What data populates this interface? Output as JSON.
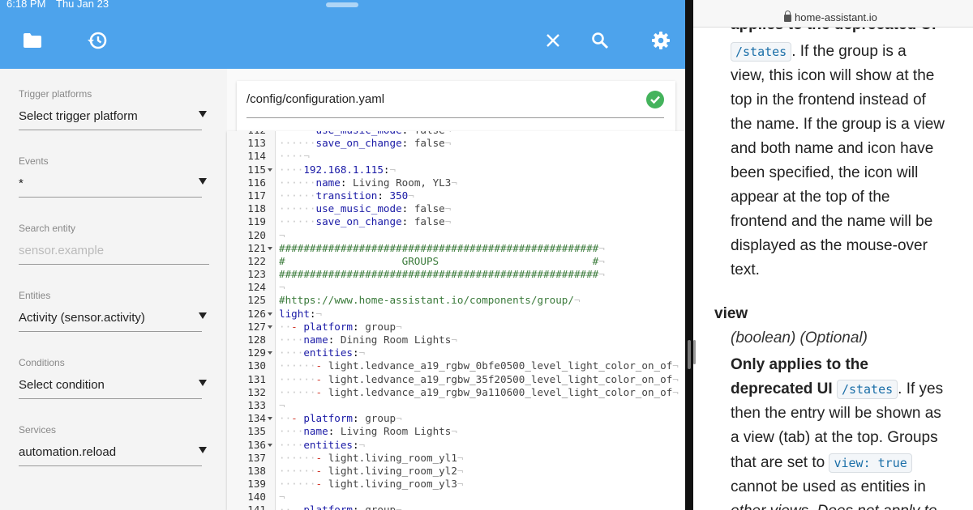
{
  "status_bar": {
    "time": "6:18 PM",
    "date": "Thu Jan 23"
  },
  "toolbar": {
    "icons": [
      "folder-icon",
      "history-icon",
      "close-icon",
      "search-icon",
      "gear-icon"
    ]
  },
  "sidebar": {
    "fields": [
      {
        "label": "Trigger platforms",
        "value": "Select trigger platform",
        "placeholder": false
      },
      {
        "label": "Events",
        "value": "*",
        "placeholder": false
      },
      {
        "label": "Search entity",
        "value": "sensor.example",
        "placeholder": true
      },
      {
        "label": "Entities",
        "value": "Activity (sensor.activity)",
        "placeholder": false
      },
      {
        "label": "Conditions",
        "value": "Select condition",
        "placeholder": false
      },
      {
        "label": "Services",
        "value": "automation.reload",
        "placeholder": false
      }
    ]
  },
  "file": {
    "path": "/config/configuration.yaml",
    "status": "valid"
  },
  "editor": {
    "lines": [
      {
        "n": "112",
        "text": "use_music_mode: false"
      },
      {
        "n": "113",
        "text": "save_on_change: false"
      },
      {
        "n": "114",
        "text": ""
      },
      {
        "n": "115",
        "text": "192.168.1.115:"
      },
      {
        "n": "116",
        "text": "name: Living Room, YL3"
      },
      {
        "n": "117",
        "text": "transition: 350"
      },
      {
        "n": "118",
        "text": "use_music_mode: false"
      },
      {
        "n": "119",
        "text": "save_on_change: false"
      },
      {
        "n": "120",
        "text": ""
      },
      {
        "n": "121",
        "text": "####################################################"
      },
      {
        "n": "122",
        "text": "#                   GROUPS                         #"
      },
      {
        "n": "123",
        "text": "####################################################"
      },
      {
        "n": "124",
        "text": ""
      },
      {
        "n": "125",
        "text": "#https://www.home-assistant.io/components/group/"
      },
      {
        "n": "126",
        "text": "light:"
      },
      {
        "n": "127",
        "text": "- platform: group"
      },
      {
        "n": "128",
        "text": "name: Dining Room Lights"
      },
      {
        "n": "129",
        "text": "entities:"
      },
      {
        "n": "130",
        "text": "- light.ledvance_a19_rgbw_0bfe0500_level_light_color_on_of"
      },
      {
        "n": "131",
        "text": "- light.ledvance_a19_rgbw_35f20500_level_light_color_on_of"
      },
      {
        "n": "132",
        "text": "- light.ledvance_a19_rgbw_9a110600_level_light_color_on_of"
      },
      {
        "n": "133",
        "text": ""
      },
      {
        "n": "134",
        "text": "- platform: group"
      },
      {
        "n": "135",
        "text": "name: Living Room Lights"
      },
      {
        "n": "136",
        "text": "entities:"
      },
      {
        "n": "137",
        "text": "- light.living_room_yl1"
      },
      {
        "n": "138",
        "text": "- light.living_room_yl2"
      },
      {
        "n": "139",
        "text": "- light.living_room_yl3"
      },
      {
        "n": "140",
        "text": ""
      },
      {
        "n": "141",
        "text": "- platform: group"
      }
    ]
  },
  "browser": {
    "url": "home-assistant.io",
    "doc": {
      "line0": "applies to the deprecated UI",
      "states_code": "/states",
      "line1_rest": ". If the group is a",
      "line2": "view, this icon will show at the",
      "line3": "top in the frontend instead of",
      "line4": "the name. If the group is a view",
      "line5": "and both name and icon have",
      "line6": "been specified, the icon will",
      "line7": "appear at the top of the",
      "line8": "frontend and the name will be",
      "line9": "displayed as the mouse-over",
      "line10": "text.",
      "section_title": "view",
      "section_type": "(boolean) (Optional)",
      "bold1": "Only applies to the",
      "bold2": "deprecated UI",
      "after_states": ". If yes",
      "line11": "then the entry will be shown as",
      "line12": "a view (tab) at the top. Groups",
      "line13_pre": "that are set to",
      "view_true_code": "view: true",
      "line14": "cannot be used as entities in",
      "line15": "other views. Does not apply to"
    }
  },
  "colors": {
    "accent": "#4da3ec",
    "valid": "#44b35c"
  }
}
